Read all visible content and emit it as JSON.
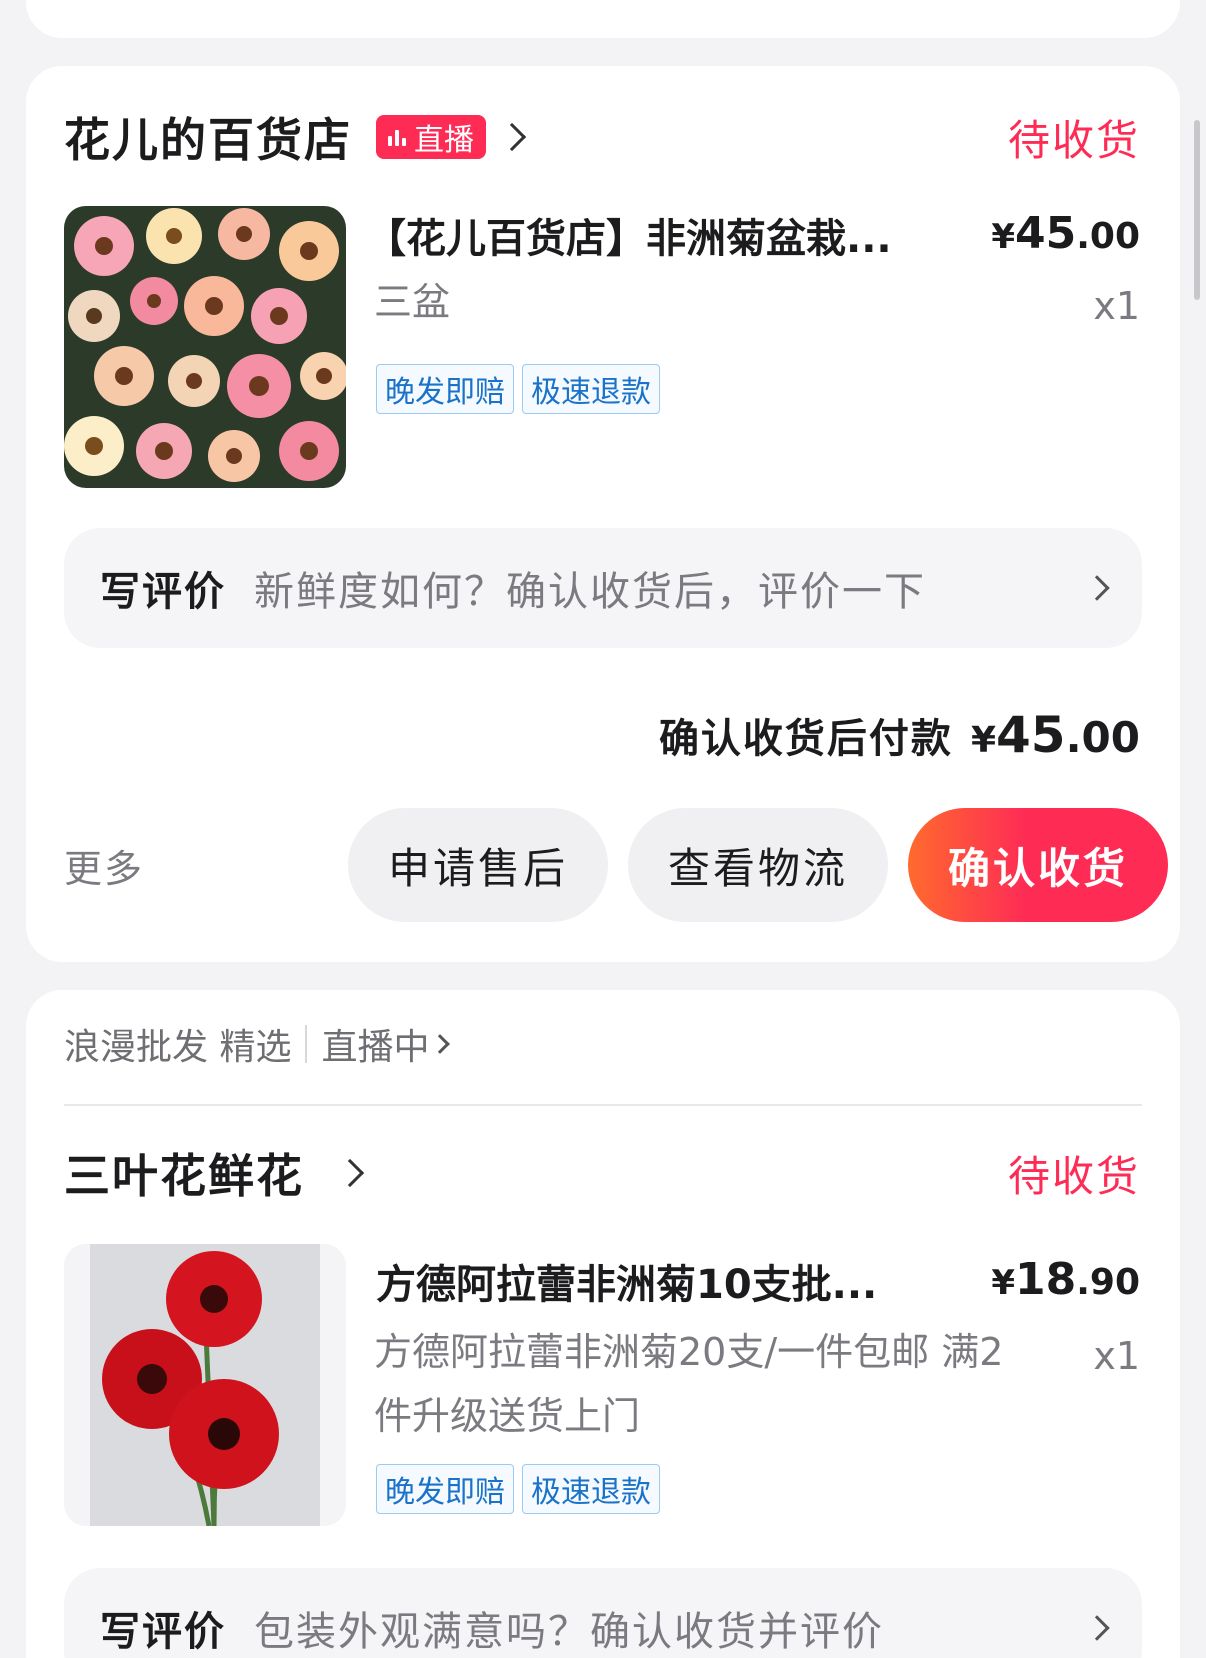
{
  "order1": {
    "shop_name": "花儿的百货店",
    "live_badge": "直播",
    "status": "待收货",
    "product_title": "【花儿百货店】非洲菊盆栽...",
    "price_symbol": "¥",
    "price_int": "45",
    "price_dec": ".00",
    "sku": "三盆",
    "qty": "x1",
    "tags": [
      "晚发即赔",
      "极速退款"
    ],
    "review_label": "写评价",
    "review_hint": "新鲜度如何？确认收货后，评价一下",
    "pay_label": "确认收货后付款",
    "pay_symbol": "¥",
    "pay_int": "45",
    "pay_dec": ".00",
    "more": "更多",
    "btn_after_sale": "申请售后",
    "btn_logistics": "查看物流",
    "btn_confirm": "确认收货"
  },
  "order2": {
    "live_source": "浪漫批发 精选",
    "live_status": "直播中",
    "shop_name": "三叶花鲜花",
    "status": "待收货",
    "product_title": "方德阿拉蕾非洲菊10支批...",
    "price_symbol": "¥",
    "price_int": "18",
    "price_dec": ".90",
    "sku": "方德阿拉蕾非洲菊20支/一件包邮 满2件升级送货上门",
    "qty": "x1",
    "tags": [
      "晚发即赔",
      "极速退款"
    ],
    "review_label": "写评价",
    "review_hint": "包装外观满意吗？确认收货并评价"
  },
  "colors": {
    "accent": "#fe2c55",
    "tag_blue": "#1a73c8",
    "background": "#f3f3f5"
  },
  "icons": [
    "live-bars-icon",
    "chevron-right-icon"
  ]
}
